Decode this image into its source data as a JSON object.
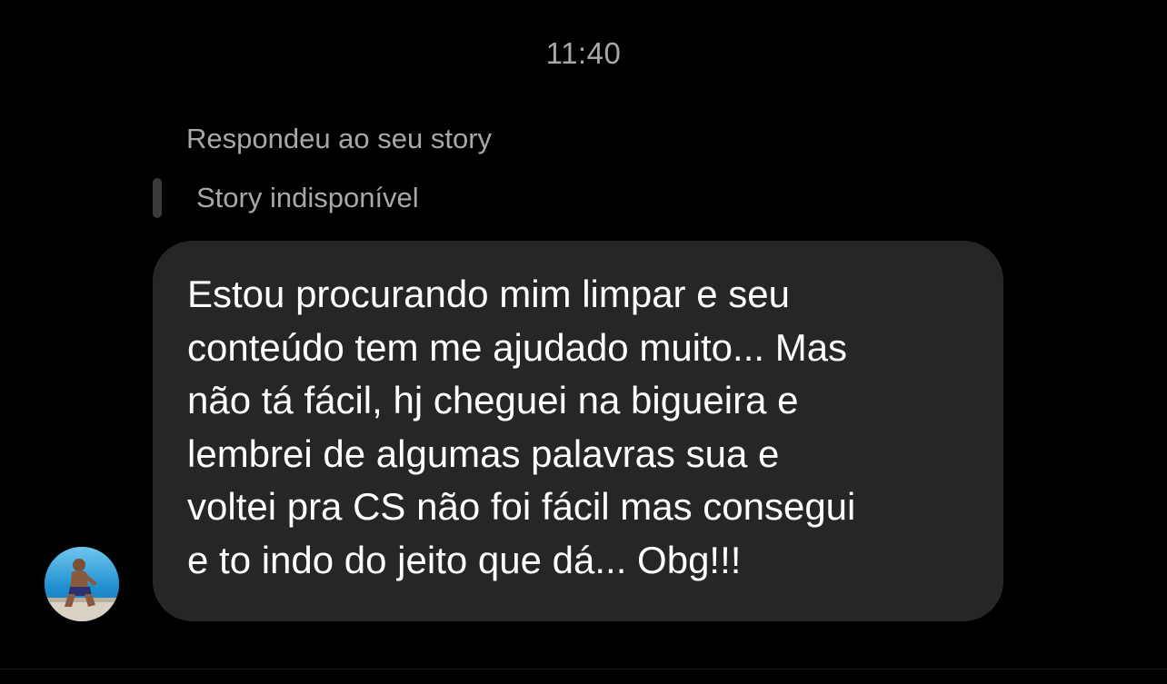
{
  "thread": {
    "timestamp": "11:40",
    "reply_label": "Respondeu ao seu story",
    "story_status": "Story indisponível"
  },
  "message": {
    "lines": [
      "Estou procurando mim limpar e seu",
      "conteúdo tem me ajudado muito... Mas",
      "não tá fácil, hj cheguei na bigueira e",
      "lembrei de algumas palavras sua e",
      "voltei pra CS não foi fácil mas consegui",
      "e to indo do jeito que dá... Obg!!!"
    ]
  },
  "sender": {
    "avatar_icon": "profile-photo-avatar"
  },
  "colors": {
    "background": "#000000",
    "bubble": "#262626",
    "secondary_text": "#a8a8a8",
    "quote_bar": "#3a3a3a"
  }
}
